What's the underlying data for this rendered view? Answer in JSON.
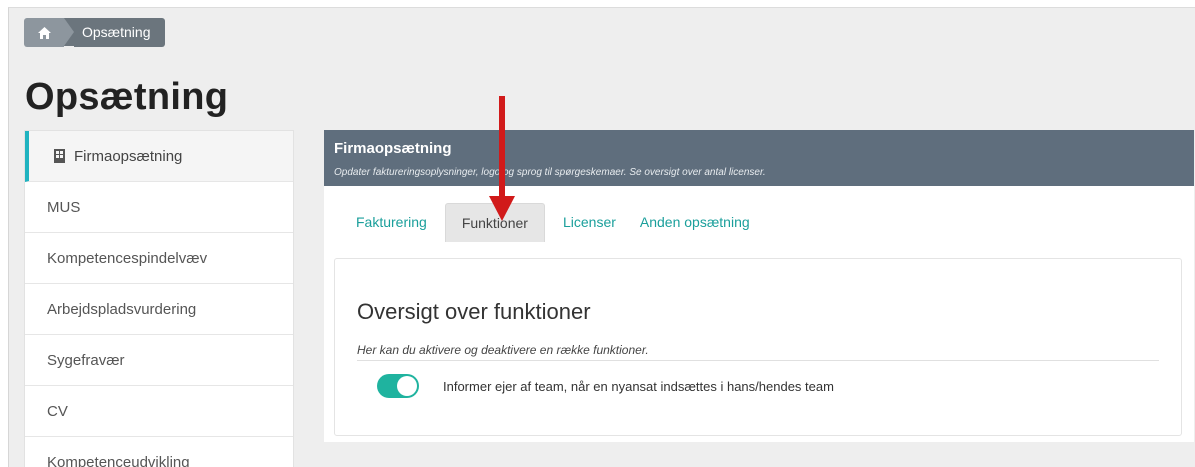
{
  "breadcrumb": {
    "current": "Opsætning"
  },
  "page": {
    "title": "Opsætning"
  },
  "sidebar": {
    "items": [
      {
        "label": "Firmaopsætning"
      },
      {
        "label": "MUS"
      },
      {
        "label": "Kompetencespindelvæv"
      },
      {
        "label": "Arbejdspladsvurdering"
      },
      {
        "label": "Sygefravær"
      },
      {
        "label": "CV"
      },
      {
        "label": "Kompetenceudvikling"
      }
    ]
  },
  "panel": {
    "title": "Firmaopsætning",
    "subtitle": "Opdater faktureringsoplysninger, logo og sprog til spørgeskemaer. Se oversigt over antal licenser.",
    "tabs": [
      {
        "label": "Fakturering"
      },
      {
        "label": "Funktioner"
      },
      {
        "label": "Licenser"
      },
      {
        "label": "Anden opsætning"
      }
    ]
  },
  "section": {
    "title": "Oversigt over funktioner",
    "description": "Her kan du aktivere og deaktivere en række funktioner.",
    "features": [
      {
        "label": "Informer ejer af team, når en nyansat indsættes i hans/hendes team",
        "enabled": true
      }
    ]
  },
  "colors": {
    "accent": "#1fb39f",
    "header": "#5f6e7d",
    "annotation_arrow": "#d11a1a"
  }
}
